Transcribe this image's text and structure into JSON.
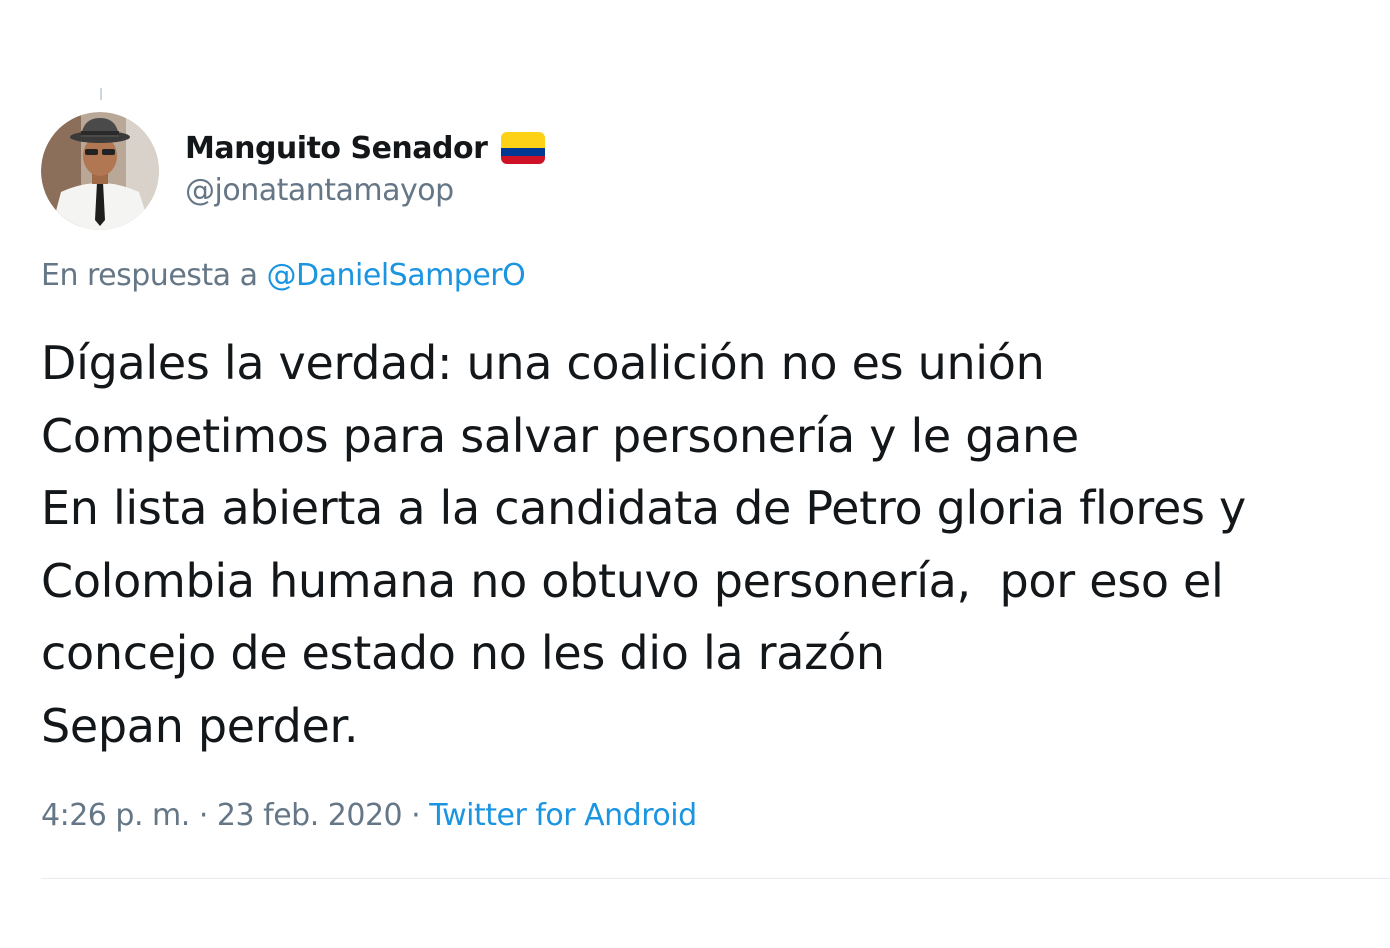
{
  "author": {
    "display_name": "Manguito Senador",
    "handle": "@jonatantamayop",
    "flag_icon": "colombia-flag-icon",
    "flag_colors": [
      "#fcd116",
      "#003893",
      "#ce1126"
    ]
  },
  "reply": {
    "prefix": "En respuesta a",
    "mention": "@DanielSamperO"
  },
  "tweet": {
    "lines": [
      "Dígales la verdad: una coalición no es unión",
      "Competimos para salvar personería y le gane",
      "En lista abierta a la candidata de Petro gloria flores y",
      "Colombia humana no obtuvo personería,  por eso el",
      "concejo de estado no les dio la razón",
      "Sepan perder."
    ]
  },
  "meta": {
    "time": "4:26 p. m.",
    "separator": "·",
    "date": "23 feb. 2020",
    "source": "Twitter for Android"
  },
  "colors": {
    "link": "#1b95e0",
    "secondary_text": "#657786",
    "primary_text": "#14171a",
    "divider": "#e6ecf0"
  }
}
